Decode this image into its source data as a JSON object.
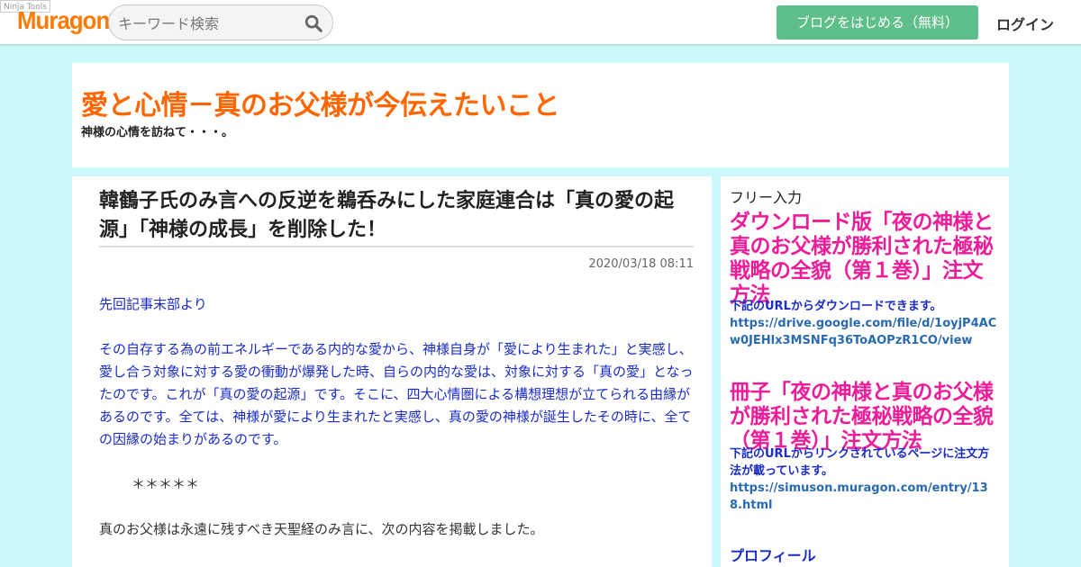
{
  "topbar": {
    "ninja_label": "Ninja Tools",
    "logo": "Muragon",
    "search_placeholder": "キーワード検索",
    "start_button": "ブログをはじめる（無料）",
    "login": "ログイン"
  },
  "blog": {
    "title": "愛と心情－真のお父様が今伝えたいこと",
    "description": "神様の心情を訪ねて・・・。"
  },
  "post": {
    "title": "韓鶴子氏のみ言への反逆を鵜呑みにした家庭連合は「真の愛の起源」「神様の成長」を削除した！",
    "date": "2020/03/18 08:11",
    "paragraphs": [
      "先回記事末部より",
      "その自存する為の前エネルギーである内的な愛から、神様自身が「愛により生まれた」と実感し、愛し合う対象に対する愛の衝動が爆発した時、自らの内的な愛は、対象に対する「真の愛」となったのです。これが「真の愛の起源」です。そこに、四大心情圏による構想理想が立てられる由縁があるのです。全ては、神様が愛により生まれたと実感し、真の愛の神様が誕生したその時に、全ての因縁の始まりがあるのです。",
      "＊＊＊＊＊",
      "真のお父様は永遠に残すべき天聖経のみ言に、次の内容を掲載しました。"
    ]
  },
  "sidebar": {
    "heading": "フリー入力",
    "block1_title": "ダウンロード版「夜の神様と真のお父様が勝利された極秘戦略の全貌（第１巻）」注文方法",
    "block1_text": "下記のURLからダウンロードできます。",
    "block1_link": "https://drive.google.com/file/d/1oyjP4ACw0JEHlx3MSNFq36ToAOPzR1CO/view",
    "block2_title": "冊子「夜の神様と真のお父様が勝利された極秘戦略の全貌（第１巻）」注文方法",
    "block2_text": "下記のURLからリンクされているページに注文方法が載っています。",
    "block2_link": "https://simuson.muragon.com/entry/138.html",
    "profile": "プロフィール"
  },
  "colors": {
    "page_bg": "#ccfafa",
    "logo": "#ff7a00",
    "blog_title": "#ff6600",
    "button": "#5fbf8a",
    "sidebar_pink": "#ee1c99",
    "blue_text": "#1a2cc8"
  },
  "icons": {
    "search": "search-icon"
  }
}
